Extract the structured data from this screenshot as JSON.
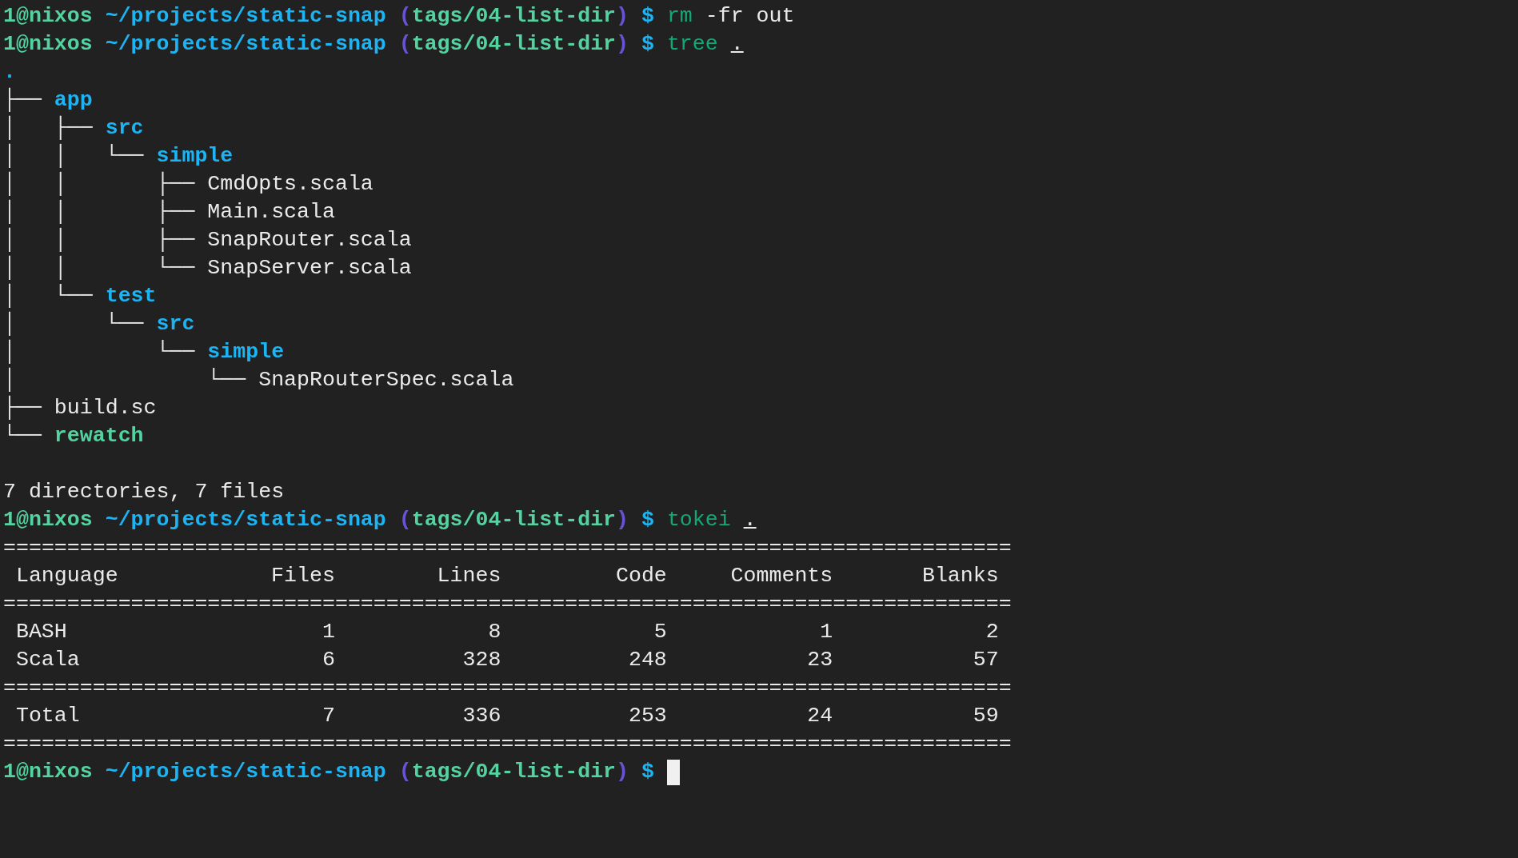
{
  "terminal": {
    "lines": [
      {
        "kind": "prompt",
        "segments": [
          {
            "text": "1@nixos",
            "kind": "user"
          },
          {
            "text": "~/projects/static-snap",
            "kind": "cwd"
          },
          {
            "text": "(",
            "kind": "paren"
          },
          {
            "text": "tags/04-list-dir",
            "kind": "branch",
            "join": true
          },
          {
            "text": ")",
            "kind": "paren",
            "join": true
          },
          {
            "text": "$",
            "kind": "symbol"
          },
          {
            "text": "rm",
            "kind": "command"
          },
          {
            "text": "-fr",
            "kind": "arg"
          },
          {
            "text": "out",
            "kind": "arg"
          }
        ]
      },
      {
        "kind": "prompt",
        "segments": [
          {
            "text": "1@nixos",
            "kind": "user"
          },
          {
            "text": "~/projects/static-snap",
            "kind": "cwd"
          },
          {
            "text": "(",
            "kind": "paren"
          },
          {
            "text": "tags/04-list-dir",
            "kind": "branch",
            "join": true
          },
          {
            "text": ")",
            "kind": "paren",
            "join": true
          },
          {
            "text": "$",
            "kind": "symbol"
          },
          {
            "text": "tree",
            "kind": "command"
          },
          {
            "text": ".",
            "kind": "path_arg"
          }
        ]
      },
      {
        "kind": "tree",
        "root": {
          "name": ".",
          "kind": "dir",
          "children": [
            {
              "name": "app",
              "prefix": "├── ",
              "kind": "dir",
              "children": [
                {
                  "name": "src",
                  "prefix": "│   ├── ",
                  "kind": "dir",
                  "children": [
                    {
                      "name": "simple",
                      "prefix": "│   │   └── ",
                      "kind": "dir",
                      "children": [
                        {
                          "name": "CmdOpts.scala",
                          "prefix": "│   │       ├── ",
                          "kind": "file"
                        },
                        {
                          "name": "Main.scala",
                          "prefix": "│   │       ├── ",
                          "kind": "file"
                        },
                        {
                          "name": "SnapRouter.scala",
                          "prefix": "│   │       ├── ",
                          "kind": "file"
                        },
                        {
                          "name": "SnapServer.scala",
                          "prefix": "│   │       └── ",
                          "kind": "file"
                        }
                      ]
                    }
                  ]
                },
                {
                  "name": "test",
                  "prefix": "│   └── ",
                  "kind": "dir",
                  "children": [
                    {
                      "name": "src",
                      "prefix": "│       └── ",
                      "kind": "dir",
                      "children": [
                        {
                          "name": "simple",
                          "prefix": "│           └── ",
                          "kind": "dir",
                          "children": [
                            {
                              "name": "SnapRouterSpec.scala",
                              "prefix": "│               └── ",
                              "kind": "file"
                            }
                          ]
                        }
                      ]
                    }
                  ]
                }
              ]
            },
            {
              "name": "build.sc",
              "prefix": "├── ",
              "kind": "file"
            },
            {
              "name": "rewatch",
              "prefix": "└── ",
              "kind": "exec"
            }
          ]
        }
      },
      {
        "kind": "blank"
      },
      {
        "kind": "text",
        "text": "7 directories, 7 files"
      },
      {
        "kind": "prompt",
        "segments": [
          {
            "text": "1@nixos",
            "kind": "user"
          },
          {
            "text": "~/projects/static-snap",
            "kind": "cwd"
          },
          {
            "text": "(",
            "kind": "paren"
          },
          {
            "text": "tags/04-list-dir",
            "kind": "branch",
            "join": true
          },
          {
            "text": ")",
            "kind": "paren",
            "join": true
          },
          {
            "text": "$",
            "kind": "symbol"
          },
          {
            "text": "tokei",
            "kind": "command"
          },
          {
            "text": ".",
            "kind": "path_arg"
          }
        ]
      },
      {
        "kind": "rule",
        "text": "==============================================================================="
      },
      {
        "kind": "table_header",
        "cells": [
          "Language",
          "Files",
          "Lines",
          "Code",
          "Comments",
          "Blanks"
        ]
      },
      {
        "kind": "rule",
        "text": "==============================================================================="
      },
      {
        "kind": "table_row",
        "cells": [
          "BASH",
          "1",
          "8",
          "5",
          "1",
          "2"
        ]
      },
      {
        "kind": "table_row",
        "cells": [
          "Scala",
          "6",
          "328",
          "248",
          "23",
          "57"
        ]
      },
      {
        "kind": "rule",
        "text": "==============================================================================="
      },
      {
        "kind": "table_row",
        "cells": [
          "Total",
          "7",
          "336",
          "253",
          "24",
          "59"
        ]
      },
      {
        "kind": "rule",
        "text": "==============================================================================="
      },
      {
        "kind": "prompt",
        "cursor": true,
        "segments": [
          {
            "text": "1@nixos",
            "kind": "user"
          },
          {
            "text": "~/projects/static-snap",
            "kind": "cwd"
          },
          {
            "text": "(",
            "kind": "paren"
          },
          {
            "text": "tags/04-list-dir",
            "kind": "branch",
            "join": true
          },
          {
            "text": ")",
            "kind": "paren",
            "join": true
          },
          {
            "text": "$",
            "kind": "symbol"
          }
        ]
      }
    ]
  }
}
